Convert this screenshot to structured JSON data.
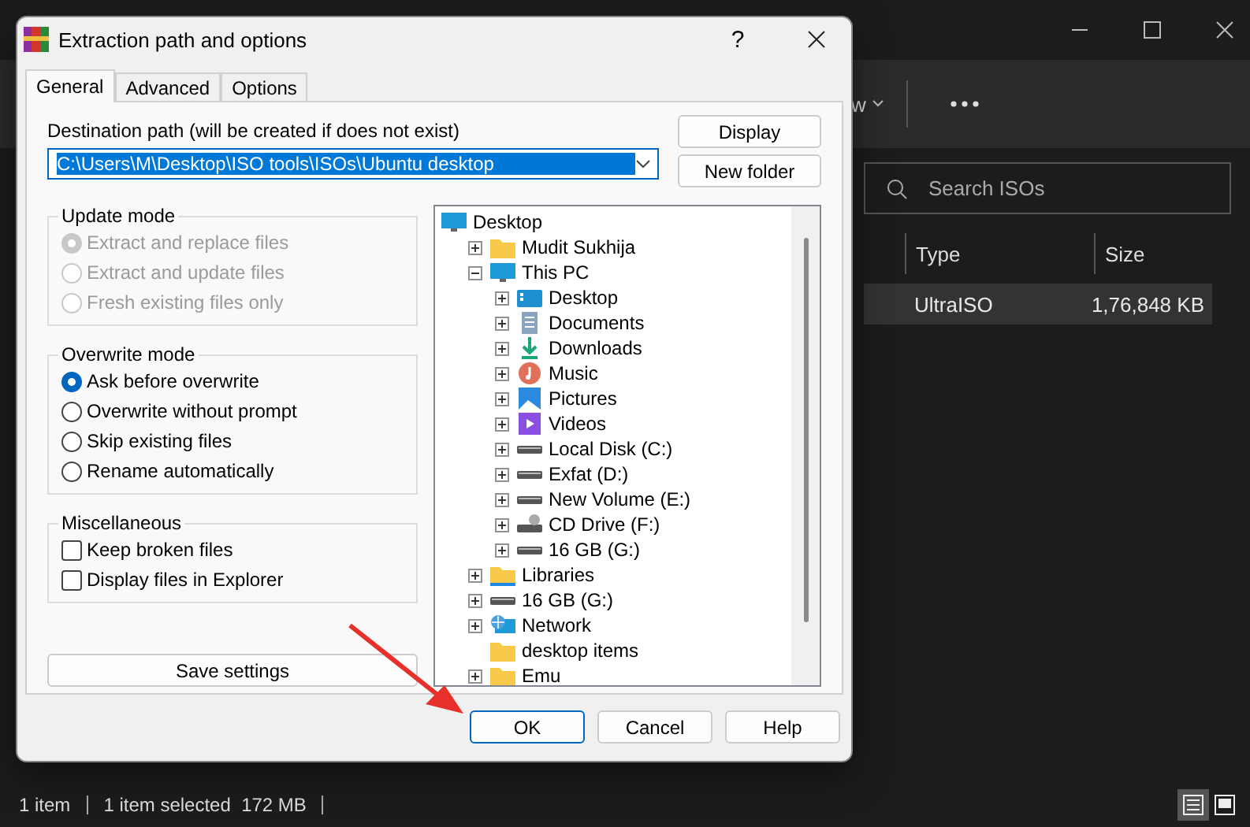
{
  "explorer": {
    "toolbar": {
      "view_label": "w"
    },
    "search": {
      "placeholder": "Search ISOs"
    },
    "columns": [
      "Type",
      "Size"
    ],
    "rows": [
      {
        "type": "UltraISO",
        "size": "1,76,848 KB",
        "selected": true
      }
    ],
    "status_bar": {
      "count": "1 item",
      "selection": "1 item selected  172 MB"
    },
    "views": [
      {
        "kind": "details",
        "selected": true
      },
      {
        "kind": "tiles",
        "selected": false
      }
    ]
  },
  "dialog": {
    "title": "Extraction path and options",
    "help": "?",
    "tabs": [
      {
        "label": "General",
        "selected": true
      },
      {
        "label": "Advanced",
        "selected": false
      },
      {
        "label": "Options",
        "selected": false
      }
    ],
    "destination": {
      "label": "Destination path (will be created if does not exist)",
      "value": "C:\\Users\\M\\Desktop\\ISO tools\\ISOs\\Ubuntu desktop"
    },
    "side_buttons": [
      "Display",
      "New folder"
    ],
    "groups": [
      {
        "title": "Update mode",
        "kind": "radio",
        "options": [
          {
            "label": "Extract and replace files",
            "selected": true,
            "disabled": true
          },
          {
            "label": "Extract and update files",
            "selected": false,
            "disabled": true
          },
          {
            "label": "Fresh existing files only",
            "selected": false,
            "disabled": true
          }
        ]
      },
      {
        "title": "Overwrite mode",
        "kind": "radio",
        "options": [
          {
            "label": "Ask before overwrite",
            "selected": true,
            "disabled": false
          },
          {
            "label": "Overwrite without prompt",
            "selected": false,
            "disabled": false
          },
          {
            "label": "Skip existing files",
            "selected": false,
            "disabled": false
          },
          {
            "label": "Rename automatically",
            "selected": false,
            "disabled": false
          }
        ]
      },
      {
        "title": "Miscellaneous",
        "kind": "checkbox",
        "options": [
          {
            "label": "Keep broken files",
            "checked": false,
            "disabled": false
          },
          {
            "label": "Display files in Explorer",
            "checked": false,
            "disabled": false
          }
        ]
      }
    ],
    "save_button": "Save settings",
    "tree": [
      {
        "label": "Desktop",
        "kind": "monitor",
        "children": [
          {
            "label": "Mudit Sukhija",
            "kind": "folder",
            "expanded": false
          },
          {
            "label": "This PC",
            "kind": "monitor",
            "expanded": true,
            "children": [
              {
                "label": "Desktop",
                "kind": "desktop",
                "expanded": false
              },
              {
                "label": "Documents",
                "kind": "documents",
                "expanded": false
              },
              {
                "label": "Downloads",
                "kind": "download",
                "expanded": false
              },
              {
                "label": "Music",
                "kind": "music",
                "expanded": false
              },
              {
                "label": "Pictures",
                "kind": "pictures",
                "expanded": false
              },
              {
                "label": "Videos",
                "kind": "videos",
                "expanded": false
              },
              {
                "label": "Local Disk (C:)",
                "kind": "disk",
                "expanded": false
              },
              {
                "label": "Exfat (D:)",
                "kind": "disk",
                "expanded": false
              },
              {
                "label": "New Volume (E:)",
                "kind": "disk",
                "expanded": false
              },
              {
                "label": "CD Drive (F:)",
                "kind": "cd",
                "expanded": false
              },
              {
                "label": "16 GB (G:)",
                "kind": "disk",
                "expanded": false
              }
            ]
          },
          {
            "label": "Libraries",
            "kind": "library",
            "expanded": false
          },
          {
            "label": "16 GB (G:)",
            "kind": "disk",
            "expanded": false
          },
          {
            "label": "Network",
            "kind": "network",
            "expanded": false
          },
          {
            "label": "desktop items",
            "kind": "folder"
          },
          {
            "label": "Emu",
            "kind": "folder",
            "expanded": false
          }
        ]
      }
    ],
    "buttons": [
      {
        "label": "OK",
        "default": true
      },
      {
        "label": "Cancel",
        "default": false
      },
      {
        "label": "Help",
        "default": false
      }
    ]
  }
}
